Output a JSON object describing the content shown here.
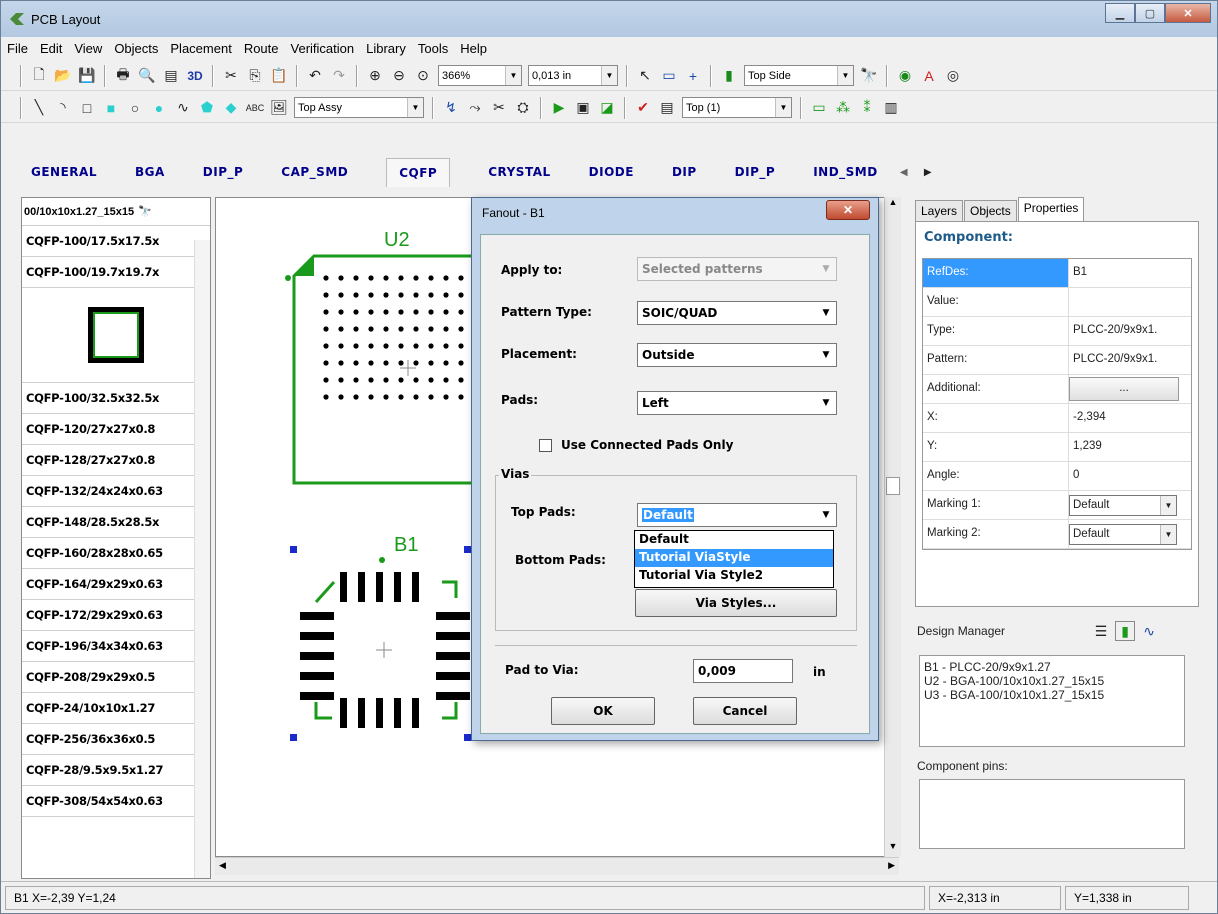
{
  "window": {
    "title": "PCB Layout"
  },
  "menu": [
    "File",
    "Edit",
    "View",
    "Objects",
    "Placement",
    "Route",
    "Verification",
    "Library",
    "Tools",
    "Help"
  ],
  "toolbar1": {
    "zoom": "366%",
    "grid": "0,013 in",
    "side": "Top Side",
    "label_3d": "3D"
  },
  "toolbar2": {
    "layer_assy": "Top Assy",
    "layer_top": "Top (1)"
  },
  "categories": [
    "GENERAL",
    "BGA",
    "DIP_P",
    "CAP_SMD",
    "CQFP",
    "CRYSTAL",
    "DIODE",
    "DIP",
    "DIP_P",
    "IND_SMD"
  ],
  "active_category": "CQFP",
  "library": {
    "search": "00/10x10x1.27_15x15",
    "items_top": [
      "CQFP-100/17.5x17.5x",
      "CQFP-100/19.7x19.7x"
    ],
    "items": [
      "CQFP-100/32.5x32.5x",
      "CQFP-120/27x27x0.8",
      "CQFP-128/27x27x0.8",
      "CQFP-132/24x24x0.63",
      "CQFP-148/28.5x28.5x",
      "CQFP-160/28x28x0.65",
      "CQFP-164/29x29x0.63",
      "CQFP-172/29x29x0.63",
      "CQFP-196/34x34x0.63",
      "CQFP-208/29x29x0.5",
      "CQFP-24/10x10x1.27",
      "CQFP-256/36x36x0.5",
      "CQFP-28/9.5x9.5x1.27",
      "CQFP-308/54x54x0.63"
    ]
  },
  "canvas": {
    "u2": "U2",
    "b1": "B1"
  },
  "dialog": {
    "title": "Fanout - B1",
    "apply_to_label": "Apply to:",
    "apply_to": "Selected patterns",
    "pattern_type_label": "Pattern Type:",
    "pattern_type": "SOIC/QUAD",
    "placement_label": "Placement:",
    "placement": "Outside",
    "pads_label": "Pads:",
    "pads": "Left",
    "use_connected": "Use Connected Pads Only",
    "vias_group": "Vias",
    "top_pads_label": "Top Pads:",
    "top_pads": "Default",
    "bottom_pads_label": "Bottom Pads:",
    "via_options": [
      "Default",
      "Tutorial ViaStyle",
      "Tutorial Via Style2"
    ],
    "via_styles_btn": "Via Styles...",
    "pad_to_via_label": "Pad to Via:",
    "pad_to_via": "0,009",
    "pad_to_via_unit": "in",
    "ok": "OK",
    "cancel": "Cancel"
  },
  "rpanel": {
    "tabs": [
      "Layers",
      "Objects",
      "Properties"
    ],
    "heading": "Component:",
    "props": [
      {
        "k": "RefDes:",
        "v": "B1"
      },
      {
        "k": "Value:",
        "v": ""
      },
      {
        "k": "Type:",
        "v": "PLCC-20/9x9x1."
      },
      {
        "k": "Pattern:",
        "v": "PLCC-20/9x9x1."
      },
      {
        "k": "Additional:",
        "v": "..."
      },
      {
        "k": "X:",
        "v": "-2,394"
      },
      {
        "k": "Y:",
        "v": "1,239"
      },
      {
        "k": "Angle:",
        "v": "0"
      },
      {
        "k": "Marking 1:",
        "v": "Default"
      },
      {
        "k": "Marking 2:",
        "v": "Default"
      }
    ]
  },
  "design_manager": {
    "title": "Design Manager",
    "items": [
      "B1 - PLCC-20/9x9x1.27",
      "U2 - BGA-100/10x10x1.27_15x15",
      "U3 - BGA-100/10x10x1.27_15x15"
    ],
    "pins_title": "Component pins:"
  },
  "status": {
    "pos": "B1  X=-2,39  Y=1,24",
    "x": "X=-2,313 in",
    "y": "Y=1,338 in"
  },
  "colors": {
    "green": "#1a9a1a",
    "blue_select": "#3399ff",
    "heading": "#1d5b8a"
  }
}
